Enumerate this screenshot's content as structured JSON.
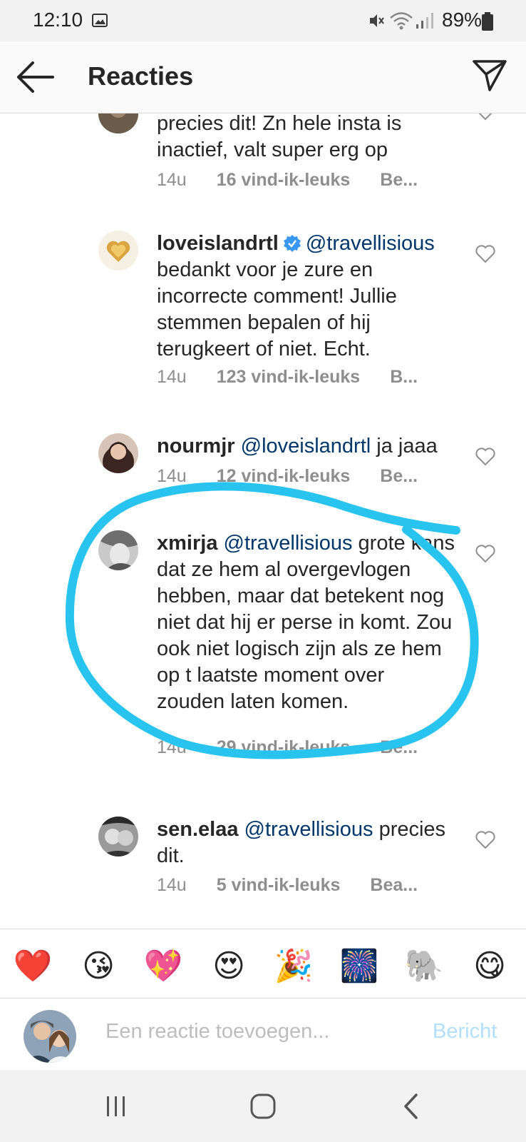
{
  "status_bar": {
    "time": "12:10",
    "battery": "89%"
  },
  "header": {
    "title": "Reacties",
    "back_icon": "arrow-left-icon",
    "send_icon": "paper-plane-icon"
  },
  "comments": [
    {
      "username": "",
      "mention": "",
      "text": "precies dit! Zn hele insta is inactief, valt super erg op",
      "time": "14u",
      "likes": "16 vind-ik-leuks",
      "reply": "Be..."
    },
    {
      "username": "loveislandrtl",
      "verified": true,
      "mention": "@travellisious",
      "text": "bedankt voor je zure en incorrecte comment! Jullie stemmen bepalen of hij terugkeert of niet. Echt.",
      "time": "14u",
      "likes": "123 vind-ik-leuks",
      "reply": "B..."
    },
    {
      "username": "nourmjr",
      "mention": "@loveislandrtl",
      "text": "ja jaaa",
      "time": "14u",
      "likes": "12 vind-ik-leuks",
      "reply": "Be..."
    },
    {
      "username": "xmirja",
      "mention": "@travellisious",
      "text": "grote kans dat ze hem al overgevlogen hebben, maar dat betekent nog niet dat hij er perse in komt. Zou ook niet logisch zijn als ze hem op t laatste moment over zouden laten komen.",
      "time": "14u",
      "likes": "29 vind-ik-leuks",
      "reply": "Be..."
    },
    {
      "username": "sen.elaa",
      "mention": "@travellisious",
      "text": "precies dit.",
      "time": "14u",
      "likes": "5 vind-ik-leuks",
      "reply": "Bea..."
    }
  ],
  "emoji_bar": [
    {
      "emoji": "❤️",
      "name": "red-heart"
    },
    {
      "emoji": "😘",
      "name": "kissing-face"
    },
    {
      "emoji": "💖",
      "name": "sparkling-heart"
    },
    {
      "emoji": "😍",
      "name": "heart-eyes"
    },
    {
      "emoji": "🎉",
      "name": "party-popper"
    },
    {
      "emoji": "🎆",
      "name": "fireworks"
    },
    {
      "emoji": "🐘",
      "name": "elephant"
    },
    {
      "emoji": "😋",
      "name": "yum-face"
    }
  ],
  "input": {
    "placeholder": "Een reactie toevoegen...",
    "post_label": "Bericht"
  },
  "colors": {
    "accent_link": "#00376b",
    "post_disabled": "#b2dffc",
    "annotation": "#29c3f0",
    "verified": "#3897f0"
  }
}
